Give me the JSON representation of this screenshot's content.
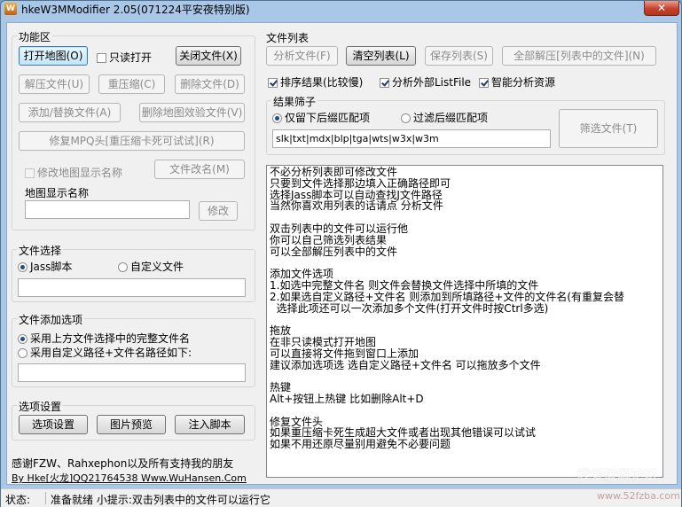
{
  "window": {
    "title": "hkeW3MModifier 2.05(071224平安夜特别版)",
    "close_label": "✕",
    "app_icon_glyph": "W"
  },
  "functions": {
    "label": "功能区",
    "open_map": "打开地图(O)",
    "readonly_open": "只读打开",
    "close_file": "关闭文件(X)",
    "extract_file": "解压文件(U)",
    "recompress": "重压缩(C)",
    "delete_file": "删除文件(D)",
    "add_replace": "添加/替换文件(A)",
    "delete_verify": "删除地图效验文件(V)",
    "repair_mpq": "修复MPQ头[重压缩卡死可试试](R)",
    "modify_display_name": "修改地图显示名称",
    "rename_file": "文件改名(M)",
    "map_display_name_label": "地图显示名称",
    "map_display_name_value": "",
    "modify_button": "修改"
  },
  "file_select": {
    "label": "文件选择",
    "opt_jass": "Jass脚本",
    "opt_custom": "自定义文件",
    "custom_value": ""
  },
  "file_add": {
    "label": "文件添加选项",
    "opt_full_name": "采用上方文件选择中的完整文件名",
    "opt_custom_path": "采用自定义路径+文件名路径如下:",
    "path_value": ""
  },
  "options": {
    "label": "选项设置",
    "settings": "选项设置",
    "preview": "图片预览",
    "inject": "注入脚本"
  },
  "credits": {
    "thanks": "感谢FZW、Rahxephon以及所有支持我的朋友",
    "author": "By Hke[火龙]QQ21764538 Www.WuHansen.Com"
  },
  "file_list": {
    "label": "文件列表",
    "analyze": "分析文件(F)",
    "clear": "清空列表(L)",
    "save": "保存列表(S)",
    "extract_all": "全部解压[列表中的文件](N)",
    "sort_results": "排序结果(比较慢)",
    "analyze_listfile": "分析外部ListFile",
    "smart_analyze": "智能分析资源"
  },
  "filter": {
    "label": "结果筛子",
    "opt_keep": "仅留下后缀匹配项",
    "opt_filter": "过滤后缀匹配项",
    "extensions": "slk|txt|mdx|blp|tga|wts|w3x|w3m",
    "filter_button": "筛选文件(T)"
  },
  "help_text": [
    "不必分析列表即可修改文件",
    "只要到文件选择那边填入正确路径即可",
    "选择Jass脚本可以自动查找J文件路径",
    "当然你喜欢用列表的话请点 分析文件",
    "",
    "双击列表中的文件可以运行他",
    "你可以自己筛选列表结果",
    "可以全部解压列表中的文件",
    "",
    "添加文件选项",
    "1.如选中完整文件名 则文件会替换文件选择中所填的文件",
    "2.如果选自定义路径+文件名 则添加到所填路径+文件的文件名(有重复会替",
    "  选择此项还可以一次添加多个文件(打开文件时按Ctrl多选)",
    "",
    "拖放",
    "在非只读模式打开地图",
    "可以直接将文件拖到窗口上添加",
    "建议添加选项选 选自定义路径+文件名 可以拖放多个文件",
    "",
    "热键",
    "Alt+按钮上热键 比如删除Alt+D",
    "",
    "修复文件头",
    "如果重压缩卡死生成超大文件或者出现其他错误可以试试",
    "如果不用还原尽量别用避免不必要问题"
  ],
  "status": {
    "label": "状态:",
    "text": "准备就绪 小提示:双击列表中的文件可以运行它"
  },
  "watermark": {
    "text": "我爱破解论坛",
    "url": "www.52fzba.com"
  }
}
